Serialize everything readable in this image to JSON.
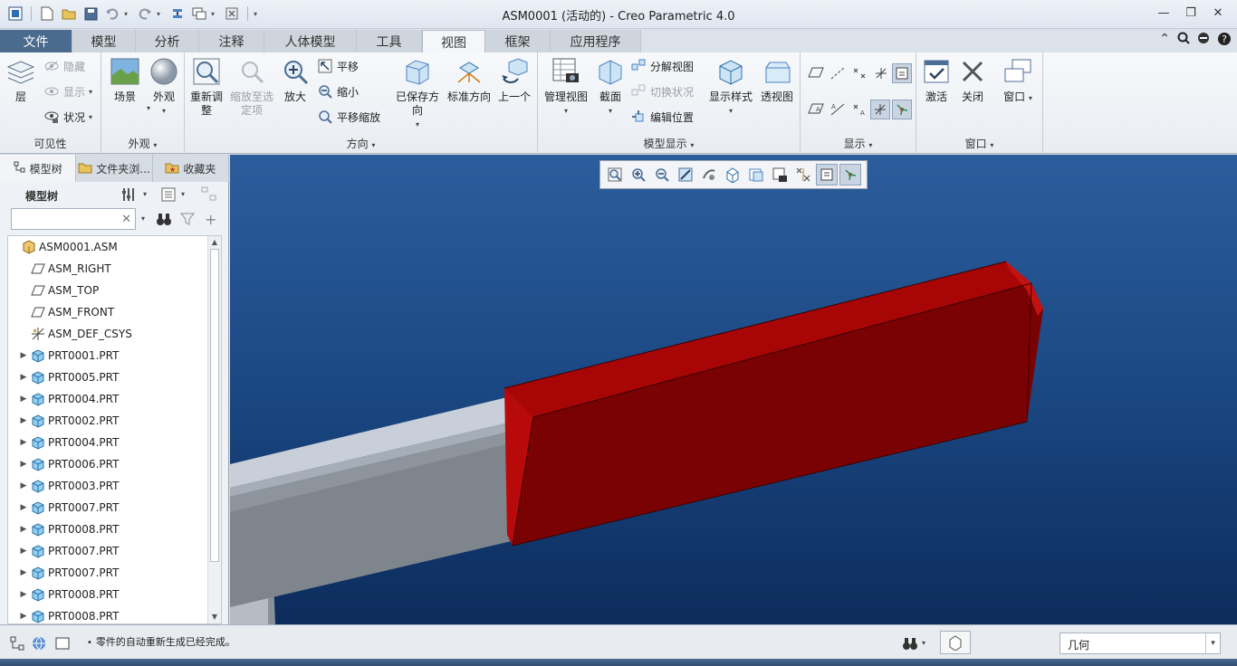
{
  "window": {
    "title": "ASM0001 (活动的) - Creo Parametric 4.0"
  },
  "tabs": [
    {
      "label": "文件"
    },
    {
      "label": "模型"
    },
    {
      "label": "分析"
    },
    {
      "label": "注释"
    },
    {
      "label": "人体模型"
    },
    {
      "label": "工具"
    },
    {
      "label": "视图"
    },
    {
      "label": "框架"
    },
    {
      "label": "应用程序"
    }
  ],
  "active_tab": "视图",
  "ribbon": {
    "visibility": {
      "label": "可见性",
      "layer": "层",
      "hide": "隐藏",
      "show": "显示",
      "status": "状况"
    },
    "appearance": {
      "label": "外观",
      "scene": "场景",
      "appearance": "外观"
    },
    "orientation": {
      "label": "方向",
      "refit": "重新调整",
      "zoom_to_selected": "缩放至选定项",
      "zoom_in": "放大",
      "pan": "平移",
      "zoom_out": "缩小",
      "pan_zoom": "平移缩放",
      "saved_orientations": "已保存方向",
      "standard_orientation": "标准方向",
      "previous": "上一个"
    },
    "model_display": {
      "label": "模型显示",
      "manage_views": "管理视图",
      "section": "截面",
      "explode_view": "分解视图",
      "toggle_status": "切换状况",
      "edit_position": "编辑位置",
      "display_style": "显示样式",
      "perspective": "透视图"
    },
    "show": {
      "label": "显示"
    },
    "window": {
      "label": "窗口",
      "activate": "激活",
      "close": "关闭",
      "windows": "窗口"
    }
  },
  "left_panel": {
    "tabs": {
      "model_tree": "模型树",
      "folder_browser": "文件夹浏...",
      "favorites": "收藏夹"
    },
    "tree_header": "模型树",
    "search_value": "",
    "items": [
      {
        "label": "ASM0001.ASM",
        "type": "asm",
        "expand": false,
        "indent": 0
      },
      {
        "label": "ASM_RIGHT",
        "type": "plane",
        "expand": false,
        "indent": 1
      },
      {
        "label": "ASM_TOP",
        "type": "plane",
        "expand": false,
        "indent": 1
      },
      {
        "label": "ASM_FRONT",
        "type": "plane",
        "expand": false,
        "indent": 1
      },
      {
        "label": "ASM_DEF_CSYS",
        "type": "csys",
        "expand": false,
        "indent": 1
      },
      {
        "label": "PRT0001.PRT",
        "type": "part",
        "expand": true,
        "indent": 1
      },
      {
        "label": "PRT0005.PRT",
        "type": "part",
        "expand": true,
        "indent": 1
      },
      {
        "label": "PRT0004.PRT",
        "type": "part",
        "expand": true,
        "indent": 1
      },
      {
        "label": "PRT0002.PRT",
        "type": "part",
        "expand": true,
        "indent": 1
      },
      {
        "label": "PRT0004.PRT",
        "type": "part",
        "expand": true,
        "indent": 1
      },
      {
        "label": "PRT0006.PRT",
        "type": "part",
        "expand": true,
        "indent": 1
      },
      {
        "label": "PRT0003.PRT",
        "type": "part",
        "expand": true,
        "indent": 1
      },
      {
        "label": "PRT0007.PRT",
        "type": "part",
        "expand": true,
        "indent": 1
      },
      {
        "label": "PRT0008.PRT",
        "type": "part",
        "expand": true,
        "indent": 1
      },
      {
        "label": "PRT0007.PRT",
        "type": "part",
        "expand": true,
        "indent": 1
      },
      {
        "label": "PRT0007.PRT",
        "type": "part",
        "expand": true,
        "indent": 1
      },
      {
        "label": "PRT0008.PRT",
        "type": "part",
        "expand": true,
        "indent": 1
      },
      {
        "label": "PRT0008.PRT",
        "type": "part",
        "expand": true,
        "indent": 1
      }
    ]
  },
  "status": {
    "message": "零件的自动重新生成已经完成。",
    "filter_value": "几何"
  },
  "colors": {
    "accent": "#4a6a8e",
    "background_top": "#2c5d9c",
    "background_bottom": "#0c2c5c",
    "part_red": "#a80606",
    "part_gray": "#b7bec8"
  }
}
